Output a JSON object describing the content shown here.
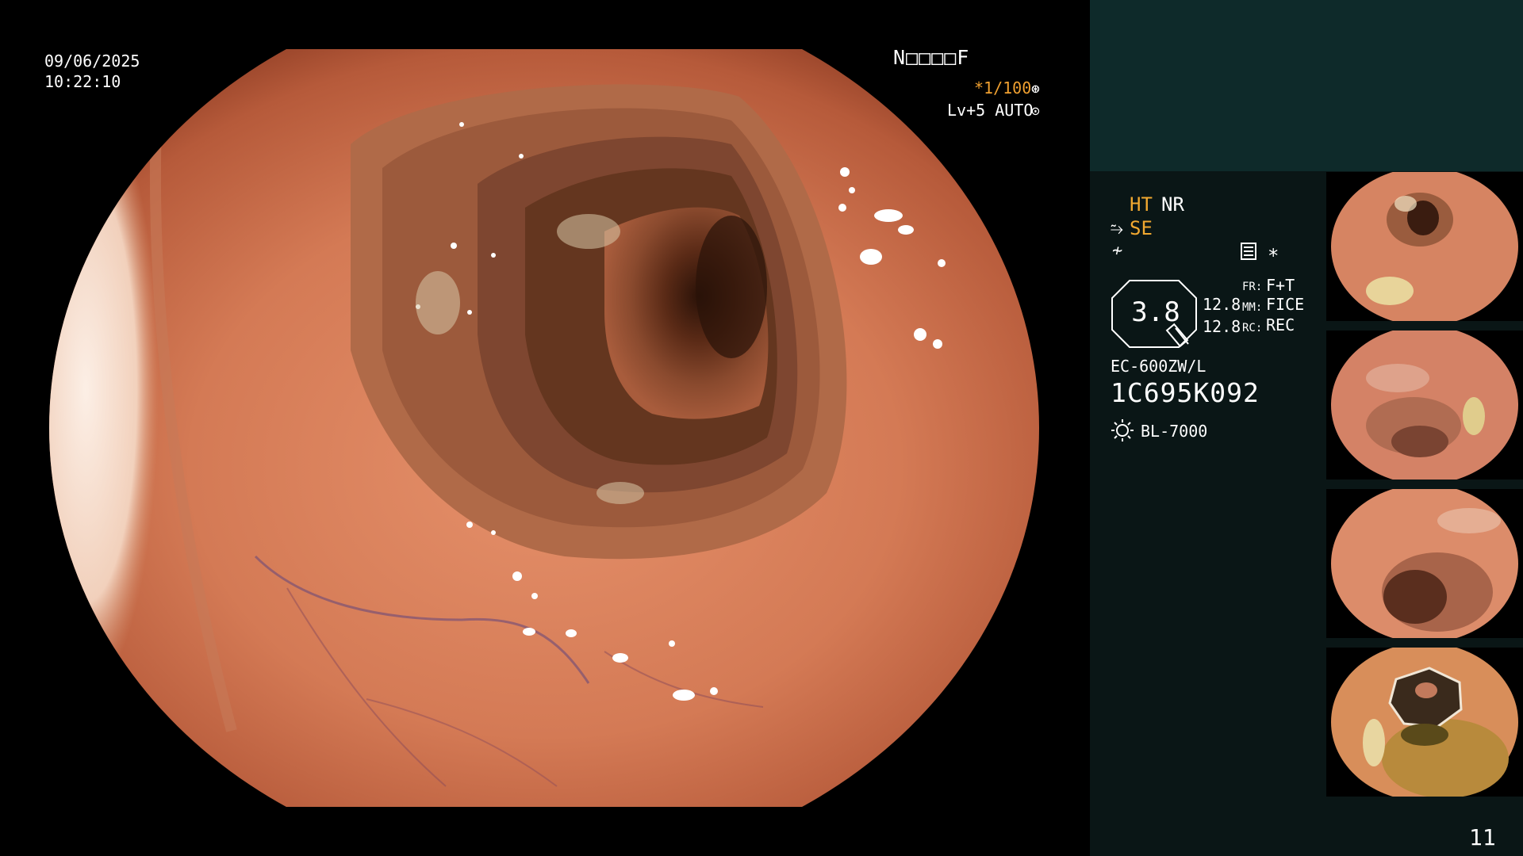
{
  "osd": {
    "date": "09/06/2025",
    "time": "10:22:10",
    "patient_id": "N□□□□F",
    "shutter": "*1/100",
    "level": "Lv+5 AUTO"
  },
  "settings": {
    "ht": "HT",
    "nr": "NR",
    "se": "SE",
    "zoom": "3.8",
    "value_a": "12.8",
    "value_b": "12.8",
    "fr_tag": "FR:",
    "fr_val": "F+T",
    "mm_tag": "MM:",
    "mm_val": "FICE",
    "rc_tag": "RC:",
    "rc_val": "REC",
    "scope_model": "EC-600ZW/L",
    "scope_serial": "1C695K092",
    "light_source": "BL-7000"
  },
  "icons": {
    "shutter_icon": "aperture-icon",
    "level_icon": "auto-iris-icon",
    "se_icon": "structure-enhance-icon",
    "f_icon": "f-icon",
    "menu_icon": "menu-icon",
    "star_icon": "asterisk-icon",
    "light_icon": "sun-icon"
  },
  "thumbnails": [
    {
      "id": "thumb-1"
    },
    {
      "id": "thumb-2"
    },
    {
      "id": "thumb-3"
    },
    {
      "id": "thumb-4"
    }
  ],
  "page_number": "11",
  "colors": {
    "osd_accent": "#f0a830",
    "panel_bg": "#0a1616",
    "panel_top": "#0e2a2a"
  }
}
